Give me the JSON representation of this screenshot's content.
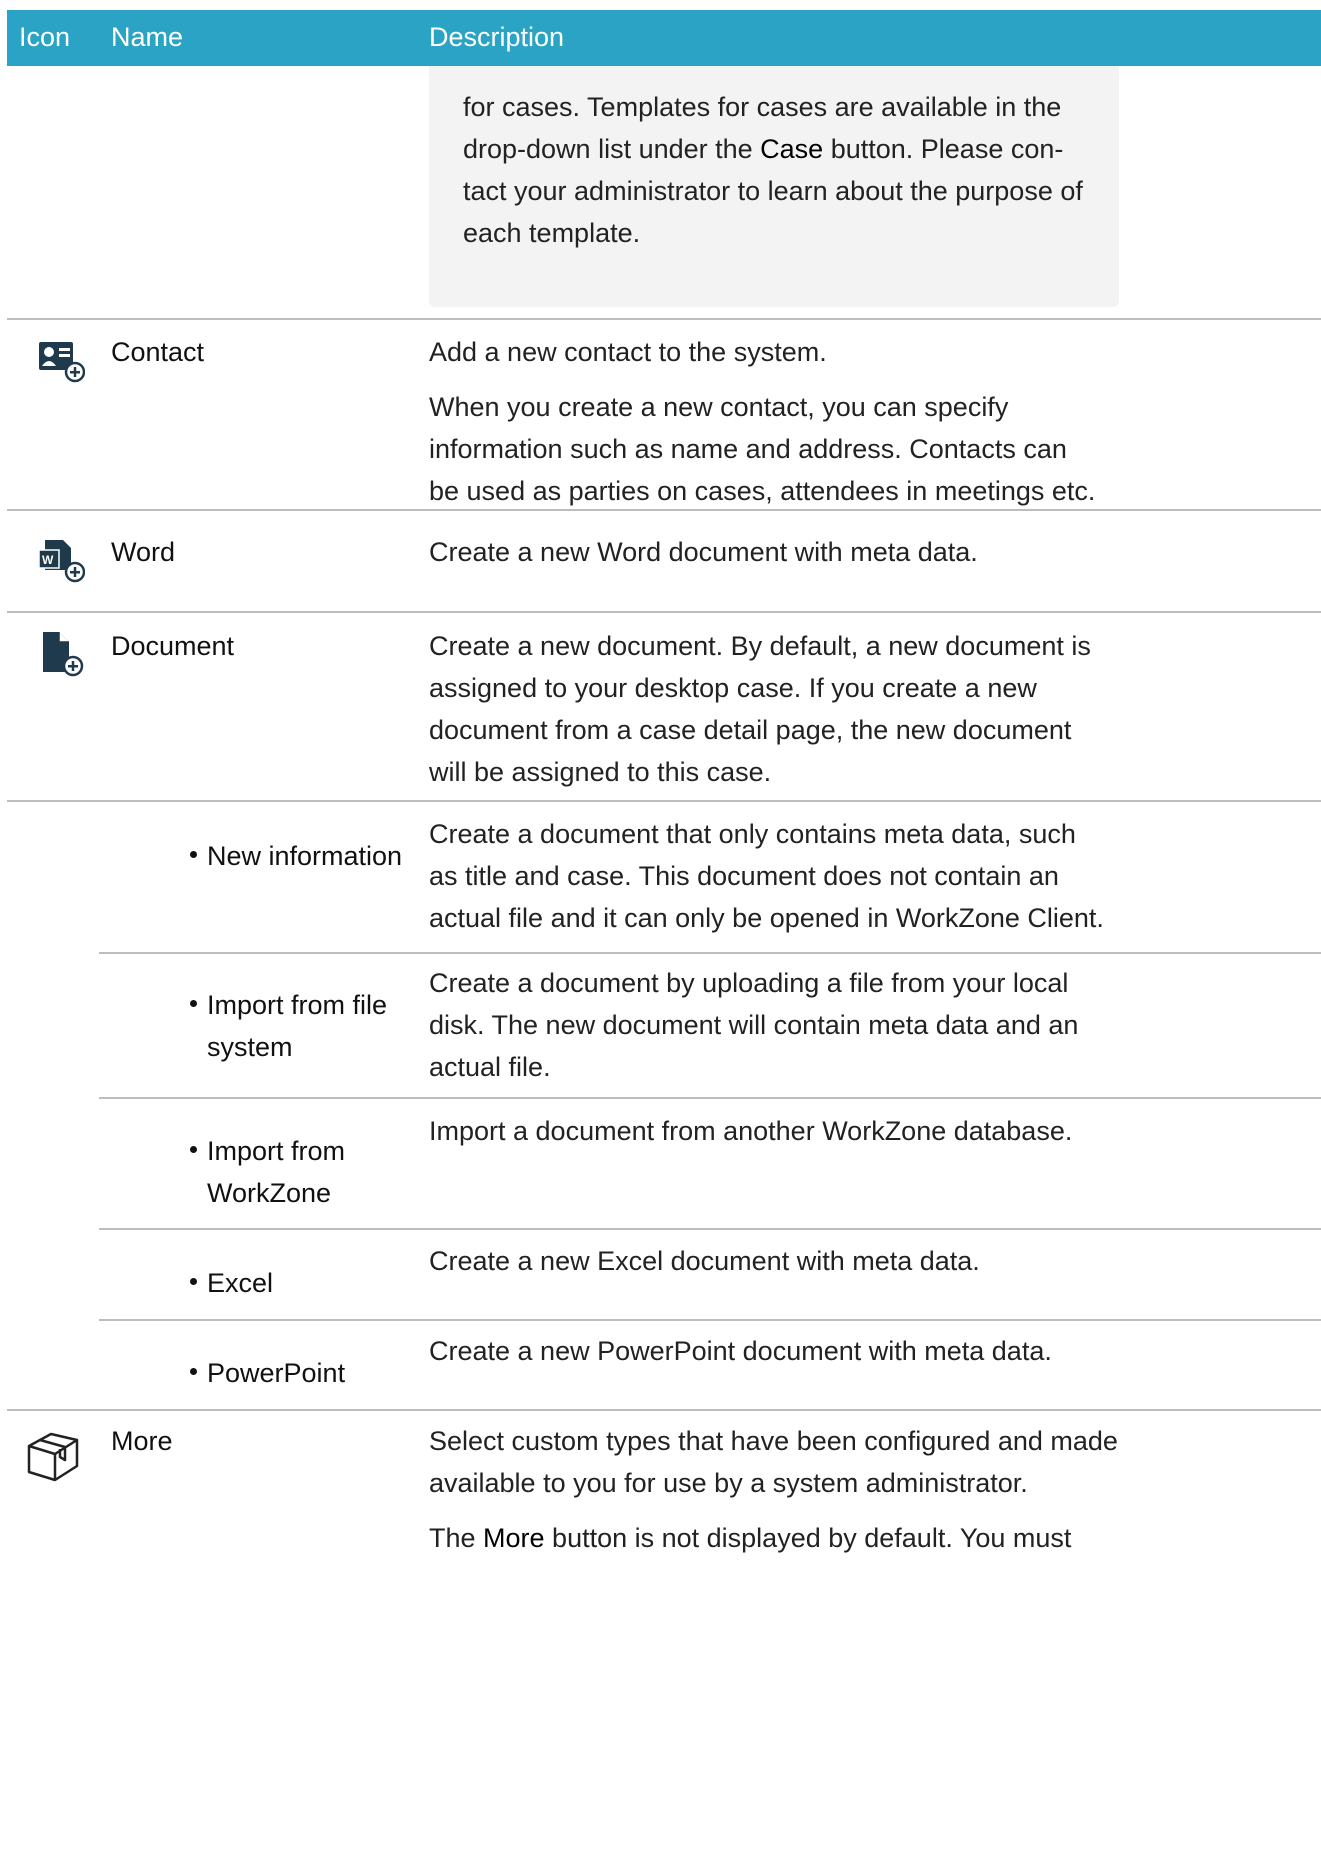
{
  "header": {
    "icon": "Icon",
    "name": "Name",
    "description": "Description"
  },
  "note": {
    "line1": "for cases. Templates for cases are available in the",
    "line2_pre": "drop-down list under the ",
    "line2_bold": "Case",
    "line2_post": " button. Please con-",
    "line3": "tact your administrator to learn about the purpose of",
    "line4": "each template."
  },
  "rows": {
    "contact": {
      "icon": "contact-card-add-icon",
      "name": "Contact",
      "desc1": "Add a new contact to the system.",
      "desc2": "When you create a new contact, you can specify information such as name and address. Contacts can be used as parties on cases, attendees in meetings etc."
    },
    "word": {
      "icon": "word-document-add-icon",
      "name": "Word",
      "desc1": "Create a new Word document with meta data."
    },
    "document": {
      "icon": "document-add-icon",
      "name": "Document",
      "desc1": "Create a new document. By default, a new document is assigned to your desktop case. If you create a new document from a case detail page, the new document will be assigned to this case."
    },
    "new_information": {
      "name": "New information",
      "desc1": "Create a document that only contains meta data, such as title and case. This document does not contain an actual file and it can only be opened in WorkZone Client."
    },
    "import_file": {
      "name_line1": "Import from file",
      "name_line2": "system",
      "desc1": "Create a document by uploading a file from your local disk. The new document will contain meta data and an actual file."
    },
    "import_workzone": {
      "name_line1": "Import from",
      "name_line2": "WorkZone",
      "desc1": "Import a document from another WorkZone database."
    },
    "excel": {
      "name": "Excel",
      "desc1": "Create a new Excel document with meta data."
    },
    "powerpoint": {
      "name": "PowerPoint",
      "desc1": "Create a new PowerPoint document with meta data."
    },
    "more": {
      "icon": "box-package-icon",
      "name": "More",
      "desc1": "Select custom types that have been configured and made available to you for use by a system administrator.",
      "desc2_pre": "The ",
      "desc2_bold": "More",
      "desc2_post": " button is not displayed by default. You must"
    }
  },
  "colors": {
    "header_bg": "#2aa3c4",
    "note_bg": "#f3f3f4",
    "icon_dark": "#1f3a4d"
  }
}
